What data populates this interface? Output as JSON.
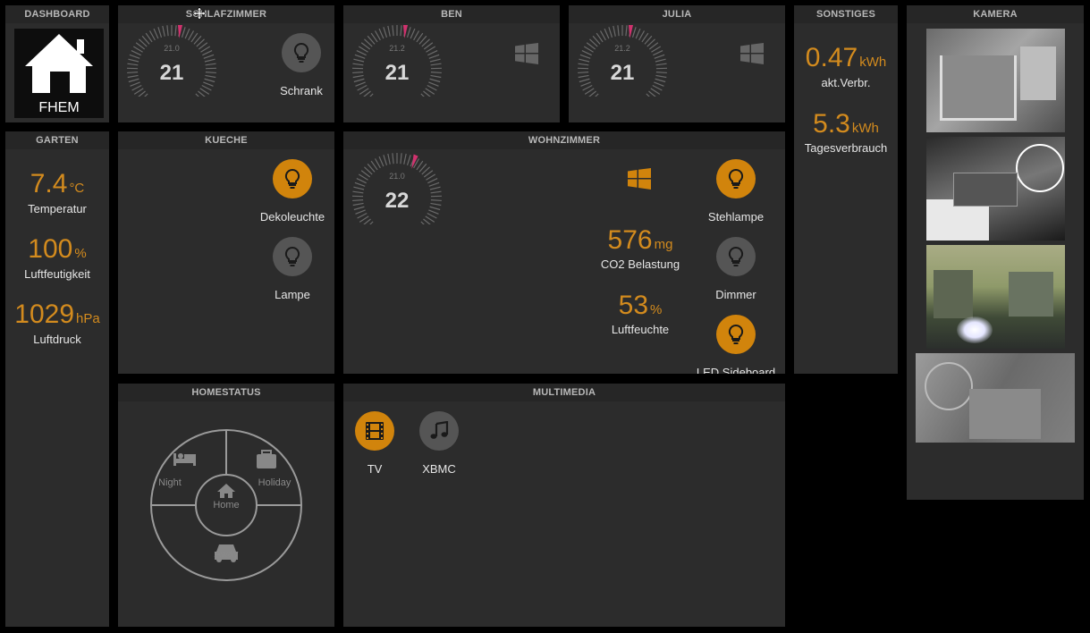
{
  "panels": {
    "dashboard": "DASHBOARD",
    "schlafzimmer": "SCHLAFZIMMER",
    "ben": "BEN",
    "julia": "JULIA",
    "sonstiges": "SONSTIGES",
    "kamera": "KAMERA",
    "garten": "GARTEN",
    "kueche": "KUECHE",
    "wohnzimmer": "WOHNZIMMER",
    "homestatus": "HOMESTATUS",
    "multimedia": "MULTIMEDIA"
  },
  "logo": {
    "text": "FHEM"
  },
  "schlafzimmer": {
    "gauge_value": "21",
    "gauge_setpoint": "21.0",
    "gauge_level": 0.55,
    "light_label": "Schrank",
    "light_on": false
  },
  "ben": {
    "gauge_value": "21",
    "gauge_setpoint": "21.2",
    "gauge_level": 0.55
  },
  "julia": {
    "gauge_value": "21",
    "gauge_setpoint": "21.2",
    "gauge_level": 0.55
  },
  "sonstiges": {
    "verbrauch_value": "0.47",
    "verbrauch_unit": "kWh",
    "verbrauch_label": "akt.Verbr.",
    "tages_value": "5.3",
    "tages_unit": "kWh",
    "tages_label": "Tagesverbrauch"
  },
  "garten": {
    "temp_value": "7.4",
    "temp_unit": "°C",
    "temp_label": "Temperatur",
    "hum_value": "100",
    "hum_unit": "%",
    "hum_label": "Luftfeutigkeit",
    "press_value": "1029",
    "press_unit": "hPa",
    "press_label": "Luftdruck"
  },
  "kueche": {
    "light1_label": "Dekoleuchte",
    "light1_on": true,
    "light2_label": "Lampe",
    "light2_on": false
  },
  "wohnzimmer": {
    "gauge_value": "22",
    "gauge_setpoint": "21.0",
    "gauge_level": 0.6,
    "co2_value": "576",
    "co2_unit": "mg",
    "co2_label": "CO2 Belastung",
    "hum_value": "53",
    "hum_unit": "%",
    "hum_label": "Luftfeuchte",
    "light1_label": "Stehlampe",
    "light1_on": true,
    "light2_label": "Dimmer",
    "light2_on": false,
    "light3_label": "LED Sideboard",
    "light3_on": true
  },
  "homestatus": {
    "night": "Night",
    "holiday": "Holiday",
    "home": "Home",
    "away": "Away"
  },
  "multimedia": {
    "tv_label": "TV",
    "xbmc_label": "XBMC"
  },
  "colors": {
    "accent": "#d1840c",
    "gauge_pointer": "#d0326e",
    "panel": "#2c2c2c",
    "background": "#000000"
  }
}
